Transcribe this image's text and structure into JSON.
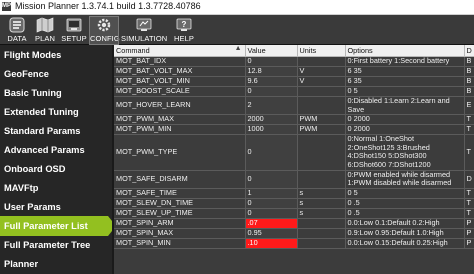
{
  "window": {
    "title": "Mission Planner 1.3.74.1 build 1.3.7728.40786",
    "icon": "MP"
  },
  "toolbar": [
    {
      "label": "DATA",
      "icon": "data-icon"
    },
    {
      "label": "PLAN",
      "icon": "plan-icon"
    },
    {
      "label": "SETUP",
      "icon": "setup-icon"
    },
    {
      "label": "CONFIG",
      "icon": "config-icon",
      "active": true
    },
    {
      "label": "SIMULATION",
      "icon": "simulation-icon"
    },
    {
      "label": "HELP",
      "icon": "help-icon"
    }
  ],
  "sidebar": {
    "items": [
      {
        "label": "Flight Modes"
      },
      {
        "label": "GeoFence"
      },
      {
        "label": "Basic Tuning"
      },
      {
        "label": "Extended Tuning"
      },
      {
        "label": "Standard Params"
      },
      {
        "label": "Advanced Params"
      },
      {
        "label": "Onboard OSD"
      },
      {
        "label": "MAVFtp"
      },
      {
        "label": "User Params"
      },
      {
        "label": "Full Parameter List",
        "active": true
      },
      {
        "label": "Full Parameter Tree"
      },
      {
        "label": "Planner"
      }
    ]
  },
  "table": {
    "headers": {
      "command": "Command",
      "sort": "▲",
      "value": "Value",
      "units": "Units",
      "options": "Options",
      "desc": "D"
    },
    "rows": [
      {
        "command": "MOT_BAT_IDX",
        "value": "0",
        "units": "",
        "options": "0:First battery 1:Second battery",
        "desc": "B"
      },
      {
        "command": "MOT_BAT_VOLT_MAX",
        "value": "12.8",
        "units": "V",
        "options": "6 35",
        "desc": "B"
      },
      {
        "command": "MOT_BAT_VOLT_MIN",
        "value": "9.6",
        "units": "V",
        "options": "6 35",
        "desc": "B"
      },
      {
        "command": "MOT_BOOST_SCALE",
        "value": "0",
        "units": "",
        "options": "0 5",
        "desc": "B"
      },
      {
        "command": "MOT_HOVER_LEARN",
        "value": "2",
        "units": "",
        "options": "0:Disabled 1:Learn 2:Learn and Save",
        "desc": "E"
      },
      {
        "command": "MOT_PWM_MAX",
        "value": "2000",
        "units": "PWM",
        "options": "0 2000",
        "desc": "T"
      },
      {
        "command": "MOT_PWM_MIN",
        "value": "1000",
        "units": "PWM",
        "options": "0 2000",
        "desc": "T"
      },
      {
        "command": "MOT_PWM_TYPE",
        "value": "0",
        "units": "",
        "options": "0:Normal 1:OneShot 2:OneShot125 3:Brushed 4:DShot150 5:DShot300 6:DShot600 7:DShot1200",
        "desc": "T"
      },
      {
        "command": "MOT_SAFE_DISARM",
        "value": "0",
        "units": "",
        "options": "0:PWM enabled while disarmed 1:PWM disabled while disarmed",
        "desc": "D"
      },
      {
        "command": "MOT_SAFE_TIME",
        "value": "1",
        "units": "s",
        "options": "0 5",
        "desc": "T"
      },
      {
        "command": "MOT_SLEW_DN_TIME",
        "value": "0",
        "units": "s",
        "options": "0 .5",
        "desc": "T"
      },
      {
        "command": "MOT_SLEW_UP_TIME",
        "value": "0",
        "units": "s",
        "options": "0 .5",
        "desc": "T"
      },
      {
        "command": "MOT_SPIN_ARM",
        "value": ".07",
        "units": "",
        "options": "0.0:Low 0.1:Default 0.2:High",
        "desc": "P",
        "highlight": true
      },
      {
        "command": "MOT_SPIN_MAX",
        "value": "0.95",
        "units": "",
        "options": "0.9:Low 0.95:Default 1.0:High",
        "desc": "P"
      },
      {
        "command": "MOT_SPIN_MIN",
        "value": ".10",
        "units": "",
        "options": "0.0:Low 0.15:Default 0.25:High",
        "desc": "P",
        "highlight": true
      }
    ]
  }
}
